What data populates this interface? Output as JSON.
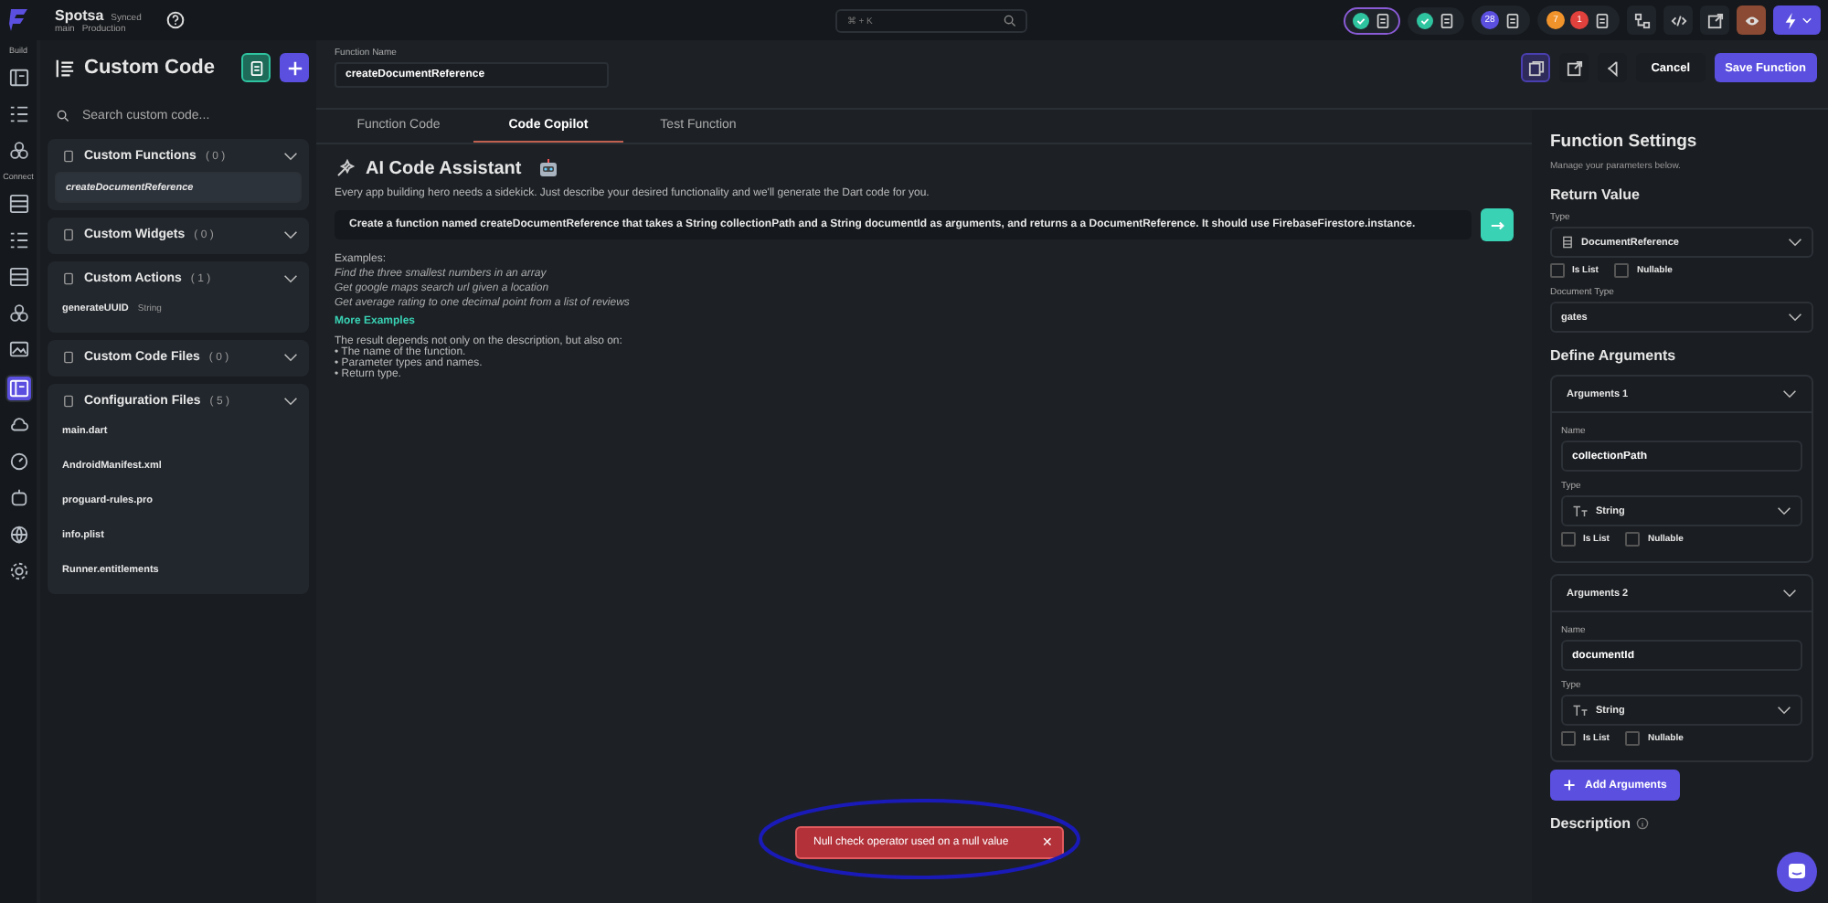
{
  "topbar": {
    "project": "Spotsa",
    "sync_status": "Synced",
    "branch": "main",
    "environment": "Production",
    "search_hint": "⌘ + K",
    "status_groups": [
      {
        "kind": "check",
        "outlined": true
      },
      {
        "kind": "check",
        "outlined": false
      },
      {
        "kind": "count",
        "outlined": false,
        "counts": [
          {
            "text": "28",
            "color": "#5b4fe0"
          }
        ]
      },
      {
        "kind": "count",
        "outlined": false,
        "counts": [
          {
            "text": "7",
            "color": "#f0932b"
          },
          {
            "text": "1",
            "color": "#e0413c"
          }
        ]
      }
    ]
  },
  "rail": {
    "sections": [
      {
        "label": "Build",
        "items": [
          {
            "selected": false
          },
          {
            "selected": false
          },
          {
            "selected": false
          }
        ]
      },
      {
        "label": "Connect",
        "items": [
          {
            "selected": false
          },
          {
            "selected": false
          },
          {
            "selected": false
          },
          {
            "selected": false
          },
          {
            "selected": false
          },
          {
            "selected": true
          },
          {
            "selected": false
          },
          {
            "selected": false
          },
          {
            "selected": false
          },
          {
            "selected": false
          },
          {
            "selected": false
          }
        ]
      }
    ]
  },
  "sidebar": {
    "title": "Custom Code",
    "search": {
      "placeholder": "Search custom code..."
    },
    "sections": [
      {
        "title": "Custom Functions",
        "count": "( 0 )",
        "expanded": true,
        "items": [
          {
            "label": "createDocumentReference",
            "selected": true
          }
        ]
      },
      {
        "title": "Custom Widgets",
        "count": "( 0 )",
        "expanded": true
      },
      {
        "title": "Custom Actions",
        "count": "( 1 )",
        "expanded": true,
        "items": [
          {
            "label": "generateUUID",
            "tag": "String",
            "selected": false
          }
        ]
      },
      {
        "title": "Custom Code Files",
        "count": "( 0 )",
        "expanded": true
      },
      {
        "title": "Configuration Files",
        "count": "( 5 )",
        "expanded": true,
        "items": [
          {
            "label": "main.dart",
            "selected": false
          },
          {
            "label": "AndroidManifest.xml",
            "selected": false
          },
          {
            "label": "proguard-rules.pro",
            "selected": false
          },
          {
            "label": "info.plist",
            "selected": false
          },
          {
            "label": "Runner.entitlements",
            "selected": false
          }
        ]
      }
    ]
  },
  "editor": {
    "function_name": {
      "label": "Function Name",
      "value": "createDocumentReference"
    },
    "cancel": "Cancel",
    "save": "Save Function",
    "tabs": [
      {
        "label": "Function Code",
        "selected": false
      },
      {
        "label": "Code Copilot",
        "selected": true
      },
      {
        "label": "Test Function",
        "selected": false
      }
    ],
    "copilot": {
      "title": "AI Code Assistant",
      "description": "Every app building hero needs a sidekick. Just describe your desired functionality and we'll generate the Dart code for you.",
      "prompt": "Create a function named createDocumentReference that takes a String collectionPath and a String documentId as arguments, and returns a a DocumentReference. It should use FirebaseFirestore.instance.",
      "examples_label": "Examples:",
      "examples": [
        "Find the three smallest numbers in an array",
        "Get google maps search url given a location",
        "Get average rating to one decimal point from a list of reviews"
      ],
      "more_examples": "More Examples",
      "note": "The result depends not only on the description, but also on:",
      "bullets": [
        "• The name of the function.",
        "• Parameter types and names.",
        "• Return type."
      ]
    },
    "toast": {
      "message": "Null check operator used on a null value",
      "close": "✕"
    }
  },
  "settings": {
    "title": "Function Settings",
    "subtitle": "Manage your parameters below.",
    "return_heading": "Return Value",
    "type_label": "Type",
    "return_type": "DocumentReference",
    "is_list": {
      "label": "Is List",
      "checked": false
    },
    "nullable": {
      "label": "Nullable",
      "checked": false
    },
    "doc_type_label": "Document Type",
    "doc_type": "gates",
    "arguments_heading": "Define Arguments",
    "arguments": [
      {
        "title": "Arguments 1",
        "expanded": true,
        "name_label": "Name",
        "name": "collectionPath",
        "type_label": "Type",
        "type": "String",
        "is_list": {
          "label": "Is List",
          "checked": false
        },
        "nullable": {
          "label": "Nullable",
          "checked": false
        }
      },
      {
        "title": "Arguments 2",
        "expanded": true,
        "name_label": "Name",
        "name": "documentId",
        "type_label": "Type",
        "type": "String",
        "is_list": {
          "label": "Is List",
          "checked": false
        },
        "nullable": {
          "label": "Nullable",
          "checked": false
        }
      }
    ],
    "add_button": "Add Arguments",
    "description_heading": "Description"
  }
}
